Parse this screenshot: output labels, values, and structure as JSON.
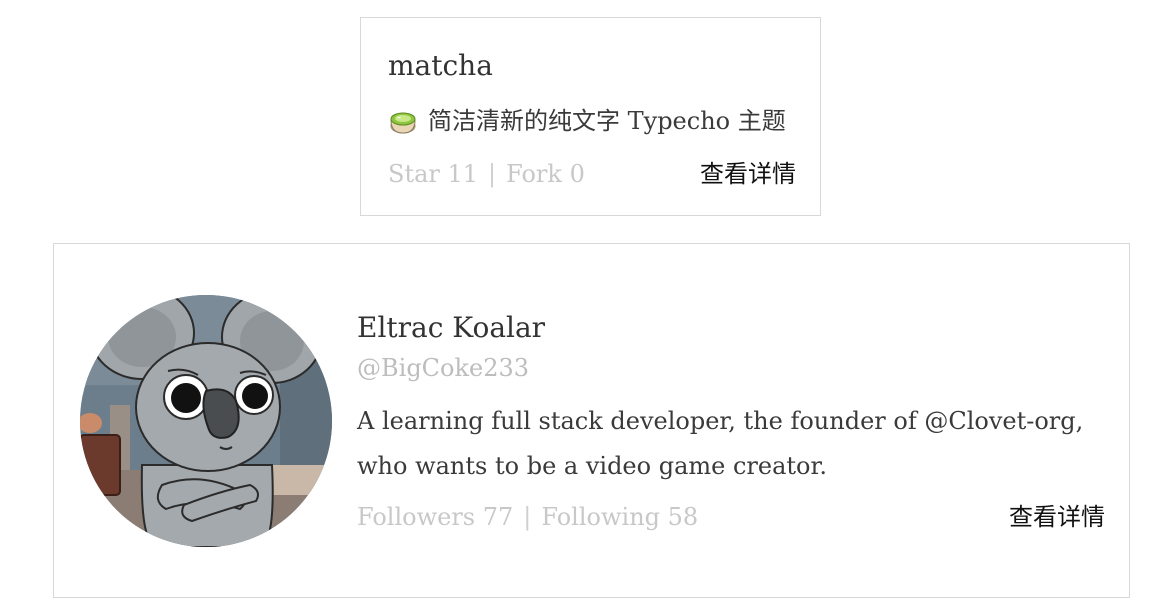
{
  "repo_card": {
    "name": "matcha",
    "description": "简洁清新的纯文字 Typecho 主题",
    "description_icon": "matcha-icon",
    "stars_label": "Star 11",
    "forks_label": "Fork 0",
    "separator": "|",
    "detail_link": "查看详情"
  },
  "user_card": {
    "name": "Eltrac Koalar",
    "handle": "@BigCoke233",
    "bio": "A learning full stack developer, the founder of @Clovet-org, who wants to be a video game creator.",
    "avatar_icon": "koala-avatar",
    "followers_label": "Followers 77",
    "following_label": "Following 58",
    "separator": "|",
    "detail_link": "查看详情"
  }
}
